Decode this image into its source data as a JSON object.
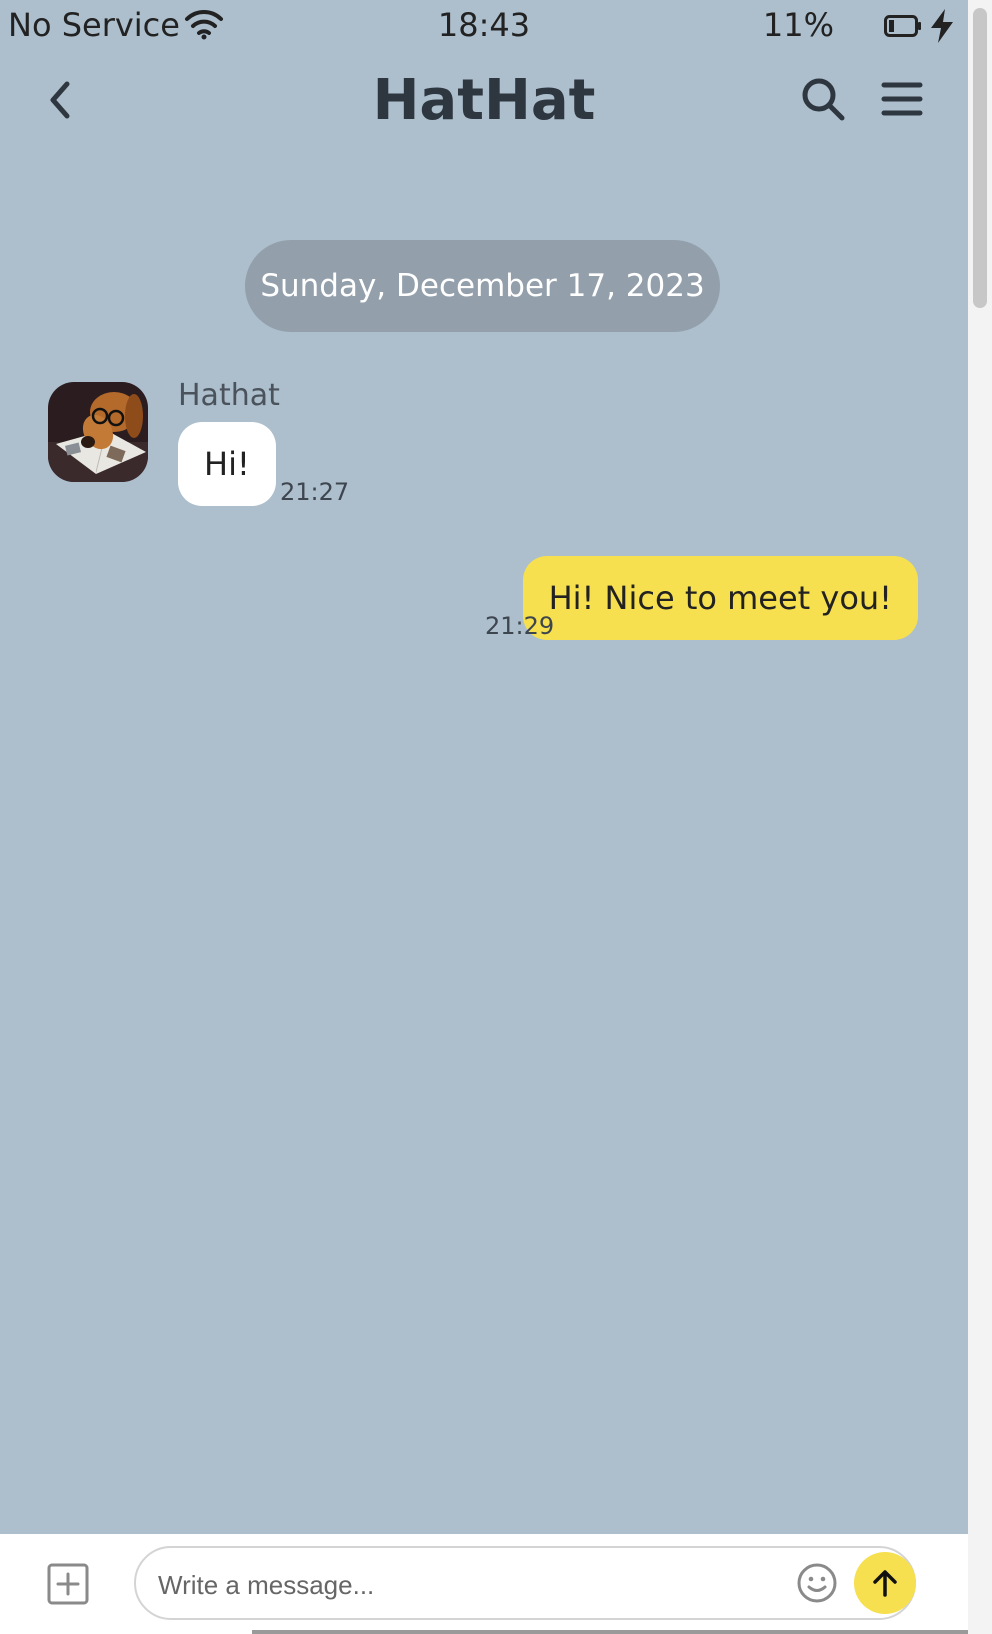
{
  "status_bar": {
    "carrier": "No Service",
    "time": "18:43",
    "battery_percent": "11%",
    "icons": [
      "wifi-icon",
      "battery-icon",
      "charging-bolt-icon"
    ]
  },
  "header": {
    "title": "HatHat",
    "icons": [
      "back-chevron-icon",
      "search-icon",
      "menu-icon"
    ]
  },
  "chat": {
    "date_separator": "Sunday, December 17, 2023",
    "messages": [
      {
        "direction": "incoming",
        "sender": "Hathat",
        "text": "Hi!",
        "time": "21:27",
        "avatar": "dachshund-with-glasses-avatar"
      },
      {
        "direction": "outgoing",
        "text": "Hi! Nice to meet you!",
        "time": "21:29"
      }
    ]
  },
  "composer": {
    "placeholder": "Write a message...",
    "value": "",
    "icons": [
      "add-attachment-icon",
      "emoji-icon",
      "send-arrow-icon"
    ]
  },
  "colors": {
    "background": "#adbfcd",
    "date_pill": "#939fab",
    "incoming_bubble": "#ffffff",
    "outgoing_bubble": "#f6e04f",
    "send_button": "#f6e04f"
  }
}
